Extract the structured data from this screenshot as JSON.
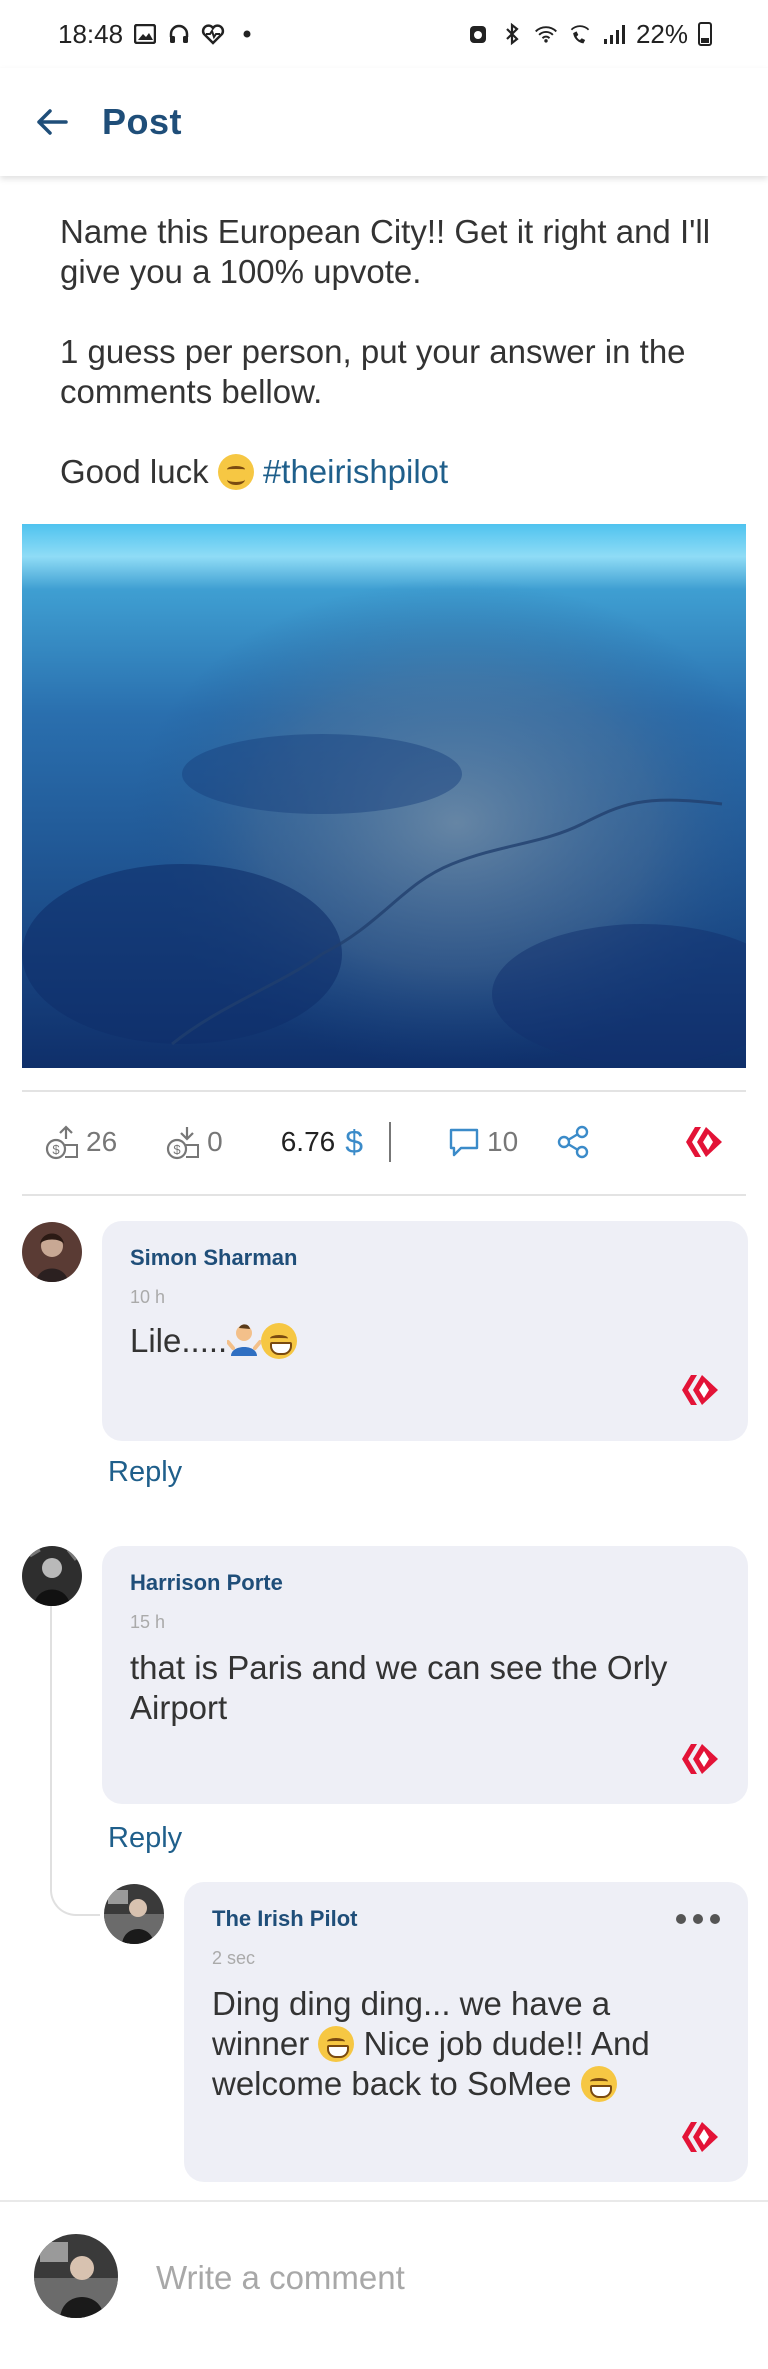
{
  "status_bar": {
    "time": "18:48",
    "battery": "22%"
  },
  "header": {
    "title": "Post"
  },
  "post": {
    "lines": [
      "Name this European City!! Get it right and I'll give you a 100% upvote.",
      "1 guess per person, put your answer in the comments bellow."
    ],
    "closing_text": "Good luck",
    "hashtag": "#theirishpilot"
  },
  "stats": {
    "upvotes": "26",
    "downvotes": "0",
    "payout": "6.76",
    "currency_symbol": "$",
    "comments": "10"
  },
  "comments": [
    {
      "author": "Simon Sharman",
      "time": "10 h",
      "text": "Lile.....",
      "reply_label": "Reply"
    },
    {
      "author": "Harrison Porte",
      "time": "15 h",
      "text": "that is Paris and we can see the Orly Airport",
      "reply_label": "Reply"
    },
    {
      "author": "The Irish Pilot",
      "time": "2 sec",
      "text_part1": "Ding ding ding... we have a winner",
      "text_part2": "Nice job dude!! And welcome back to SoMee"
    }
  ],
  "composer": {
    "placeholder": "Write a comment"
  },
  "colors": {
    "accent": "#1f4e79",
    "link": "#1f5f8b",
    "hive": "#e31337",
    "bubble": "#eeeff6"
  },
  "icons": [
    "back-arrow-icon",
    "upvote-icon",
    "downvote-icon",
    "dollar-icon",
    "comment-icon",
    "share-icon",
    "hive-icon",
    "more-icon"
  ]
}
